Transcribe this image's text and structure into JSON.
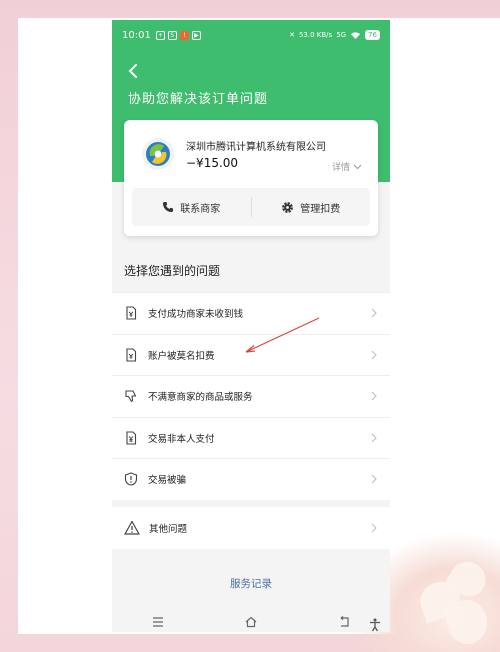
{
  "status_bar": {
    "time": "10:01",
    "net_speed": "53.0 KB/s",
    "signal": "5G",
    "battery": "76"
  },
  "header": {
    "title": "协助您解决该订单问题"
  },
  "merchant": {
    "name": "深圳市腾讯计算机系统有限公司",
    "amount": "−¥15.00",
    "detail_label": "详情",
    "contact_label": "联系商家",
    "manage_label": "管理扣费"
  },
  "problems": {
    "section_title": "选择您遇到的问题",
    "items": [
      {
        "label": "支付成功商家未收到钱",
        "icon": "receipt-icon"
      },
      {
        "label": "账户被莫名扣费",
        "icon": "receipt-icon"
      },
      {
        "label": "不满意商家的商品或服务",
        "icon": "thumbs-down-icon"
      },
      {
        "label": "交易非本人支付",
        "icon": "receipt-yen-icon"
      },
      {
        "label": "交易被骗",
        "icon": "shield-alert-icon"
      }
    ],
    "other_label": "其他问题"
  },
  "footer": {
    "service_record_label": "服务记录"
  },
  "colors": {
    "brand_green": "#3ebd6e",
    "link_blue": "#4a6fa5",
    "annotation_red": "#d9463e"
  }
}
